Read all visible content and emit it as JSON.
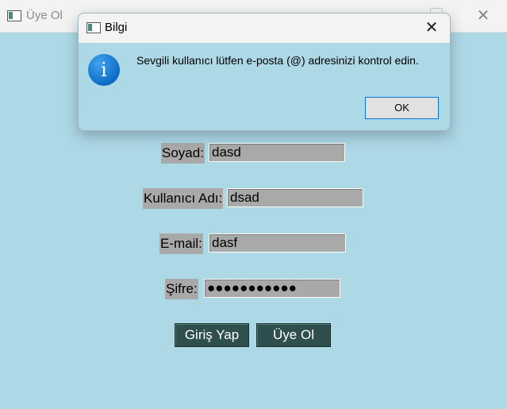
{
  "window": {
    "title": "Üye Ol"
  },
  "form": {
    "surname_label": "Soyad:",
    "surname_value": "dasd",
    "username_label": "Kullanıcı Adı:",
    "username_value": "dsad",
    "email_label": "E-mail:",
    "email_value": "dasf",
    "password_label": "Şifre:",
    "password_value": "●●●●●●●●●●●",
    "login_button": "Giriş Yap",
    "register_button": "Üye Ol"
  },
  "dialog": {
    "title": "Bilgi",
    "message": "Sevgili kullanıcı lütfen e-posta (@) adresinizi kontrol edin.",
    "ok_button": "OK",
    "icon": "info-icon"
  },
  "colors": {
    "background": "#add8e6",
    "field": "#a9a9a9",
    "button": "#2f4f4f"
  }
}
